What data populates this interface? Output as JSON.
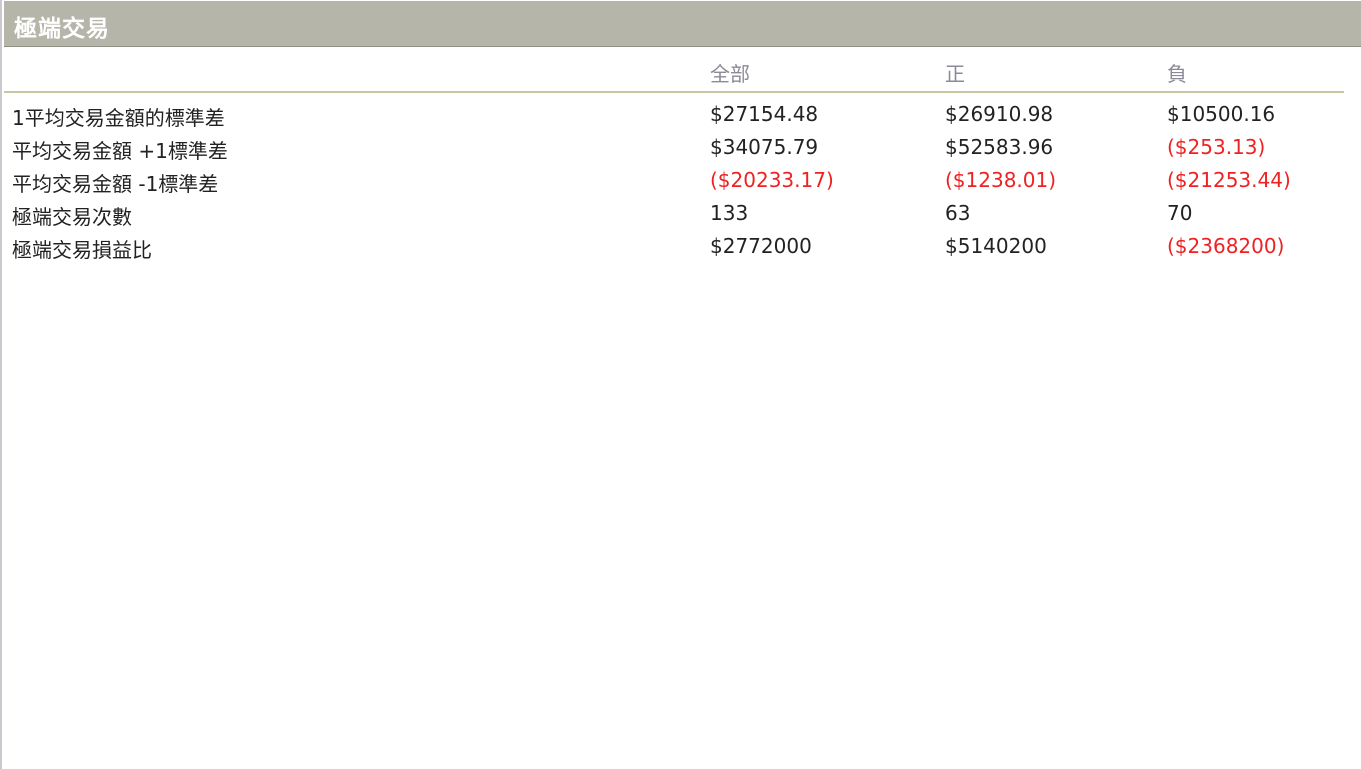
{
  "panel": {
    "title": "極端交易"
  },
  "table": {
    "columns": [
      "全部",
      "正",
      "負"
    ],
    "rows": [
      {
        "label": "1平均交易金額的標準差",
        "cells": [
          {
            "text": "$27154.48",
            "negative": false
          },
          {
            "text": "$26910.98",
            "negative": false
          },
          {
            "text": "$10500.16",
            "negative": false
          }
        ]
      },
      {
        "label": "平均交易金額 +1標準差",
        "cells": [
          {
            "text": "$34075.79",
            "negative": false
          },
          {
            "text": "$52583.96",
            "negative": false
          },
          {
            "text": "($253.13)",
            "negative": true
          }
        ]
      },
      {
        "label": "平均交易金額 -1標準差",
        "cells": [
          {
            "text": "($20233.17)",
            "negative": true
          },
          {
            "text": "($1238.01)",
            "negative": true
          },
          {
            "text": "($21253.44)",
            "negative": true
          }
        ]
      },
      {
        "label": "極端交易次數",
        "cells": [
          {
            "text": "133",
            "negative": false
          },
          {
            "text": "63",
            "negative": false
          },
          {
            "text": "70",
            "negative": false
          }
        ]
      },
      {
        "label": "極端交易損益比",
        "cells": [
          {
            "text": "$2772000",
            "negative": false
          },
          {
            "text": "$5140200",
            "negative": false
          },
          {
            "text": "($2368200)",
            "negative": true
          }
        ]
      }
    ]
  },
  "colors": {
    "title_bar": "#b5b5a9",
    "negative_text": "#ee2222",
    "header_text": "#8a8a98"
  }
}
